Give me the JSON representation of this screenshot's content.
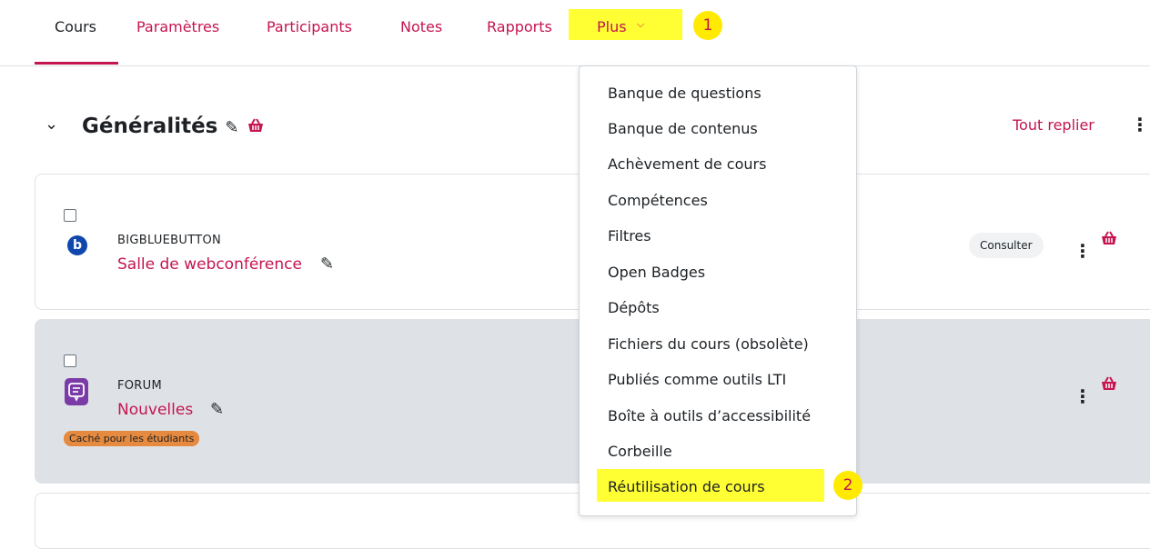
{
  "nav": {
    "items": [
      "Cours",
      "Paramètres",
      "Participants",
      "Notes",
      "Rapports"
    ],
    "more_label": "Plus",
    "step1": "1"
  },
  "section": {
    "title": "Généralités",
    "collapse_all": "Tout replier"
  },
  "activities": [
    {
      "type": "BIGBLUEBUTTON",
      "name": "Salle de webconférence",
      "action": "Consulter"
    },
    {
      "type": "FORUM",
      "name": "Nouvelles",
      "badge": "Caché pour les étudiants"
    }
  ],
  "menu": {
    "items": [
      "Banque de questions",
      "Banque de contenus",
      "Achèvement de cours",
      "Compétences",
      "Filtres",
      "Open Badges",
      "Dépôts",
      "Fichiers du cours (obsolète)",
      "Publiés comme outils LTI",
      "Boîte à outils d’accessibilité",
      "Corbeille",
      "Réutilisation de cours"
    ],
    "step2": "2"
  },
  "colors": {
    "accent": "#c4154f",
    "highlight": "#ffff33",
    "hidden_badge": "#e68a3f",
    "forum_icon": "#7b3ba7",
    "bbb_icon": "#0f47ad"
  }
}
